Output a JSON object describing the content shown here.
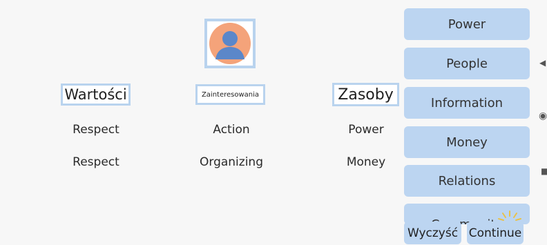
{
  "headers": {
    "values": "Wartości",
    "interests": "Zainteresowania",
    "resources": "Zasoby"
  },
  "rows": [
    {
      "values": "Respect",
      "interests": "Action",
      "resources": "Power"
    },
    {
      "values": "Respect",
      "interests": "Organizing",
      "resources": "Money"
    }
  ],
  "options": [
    "Power",
    "People",
    "Information",
    "Money",
    "Relations",
    "Community"
  ],
  "buttons": {
    "clear": "Wyczyść",
    "continue": "Continue"
  },
  "icons": {
    "avatar": "person-avatar-icon",
    "side_1": "triangle-left-icon",
    "side_2": "radio-dot-icon",
    "side_3": "square-icon",
    "sparkle": "sparkle-icon"
  },
  "colors": {
    "accent": "#bcd5f1",
    "header_border": "#b9d3ee",
    "avatar_bg": "#f4a37a",
    "avatar_person": "#5b87c9"
  }
}
